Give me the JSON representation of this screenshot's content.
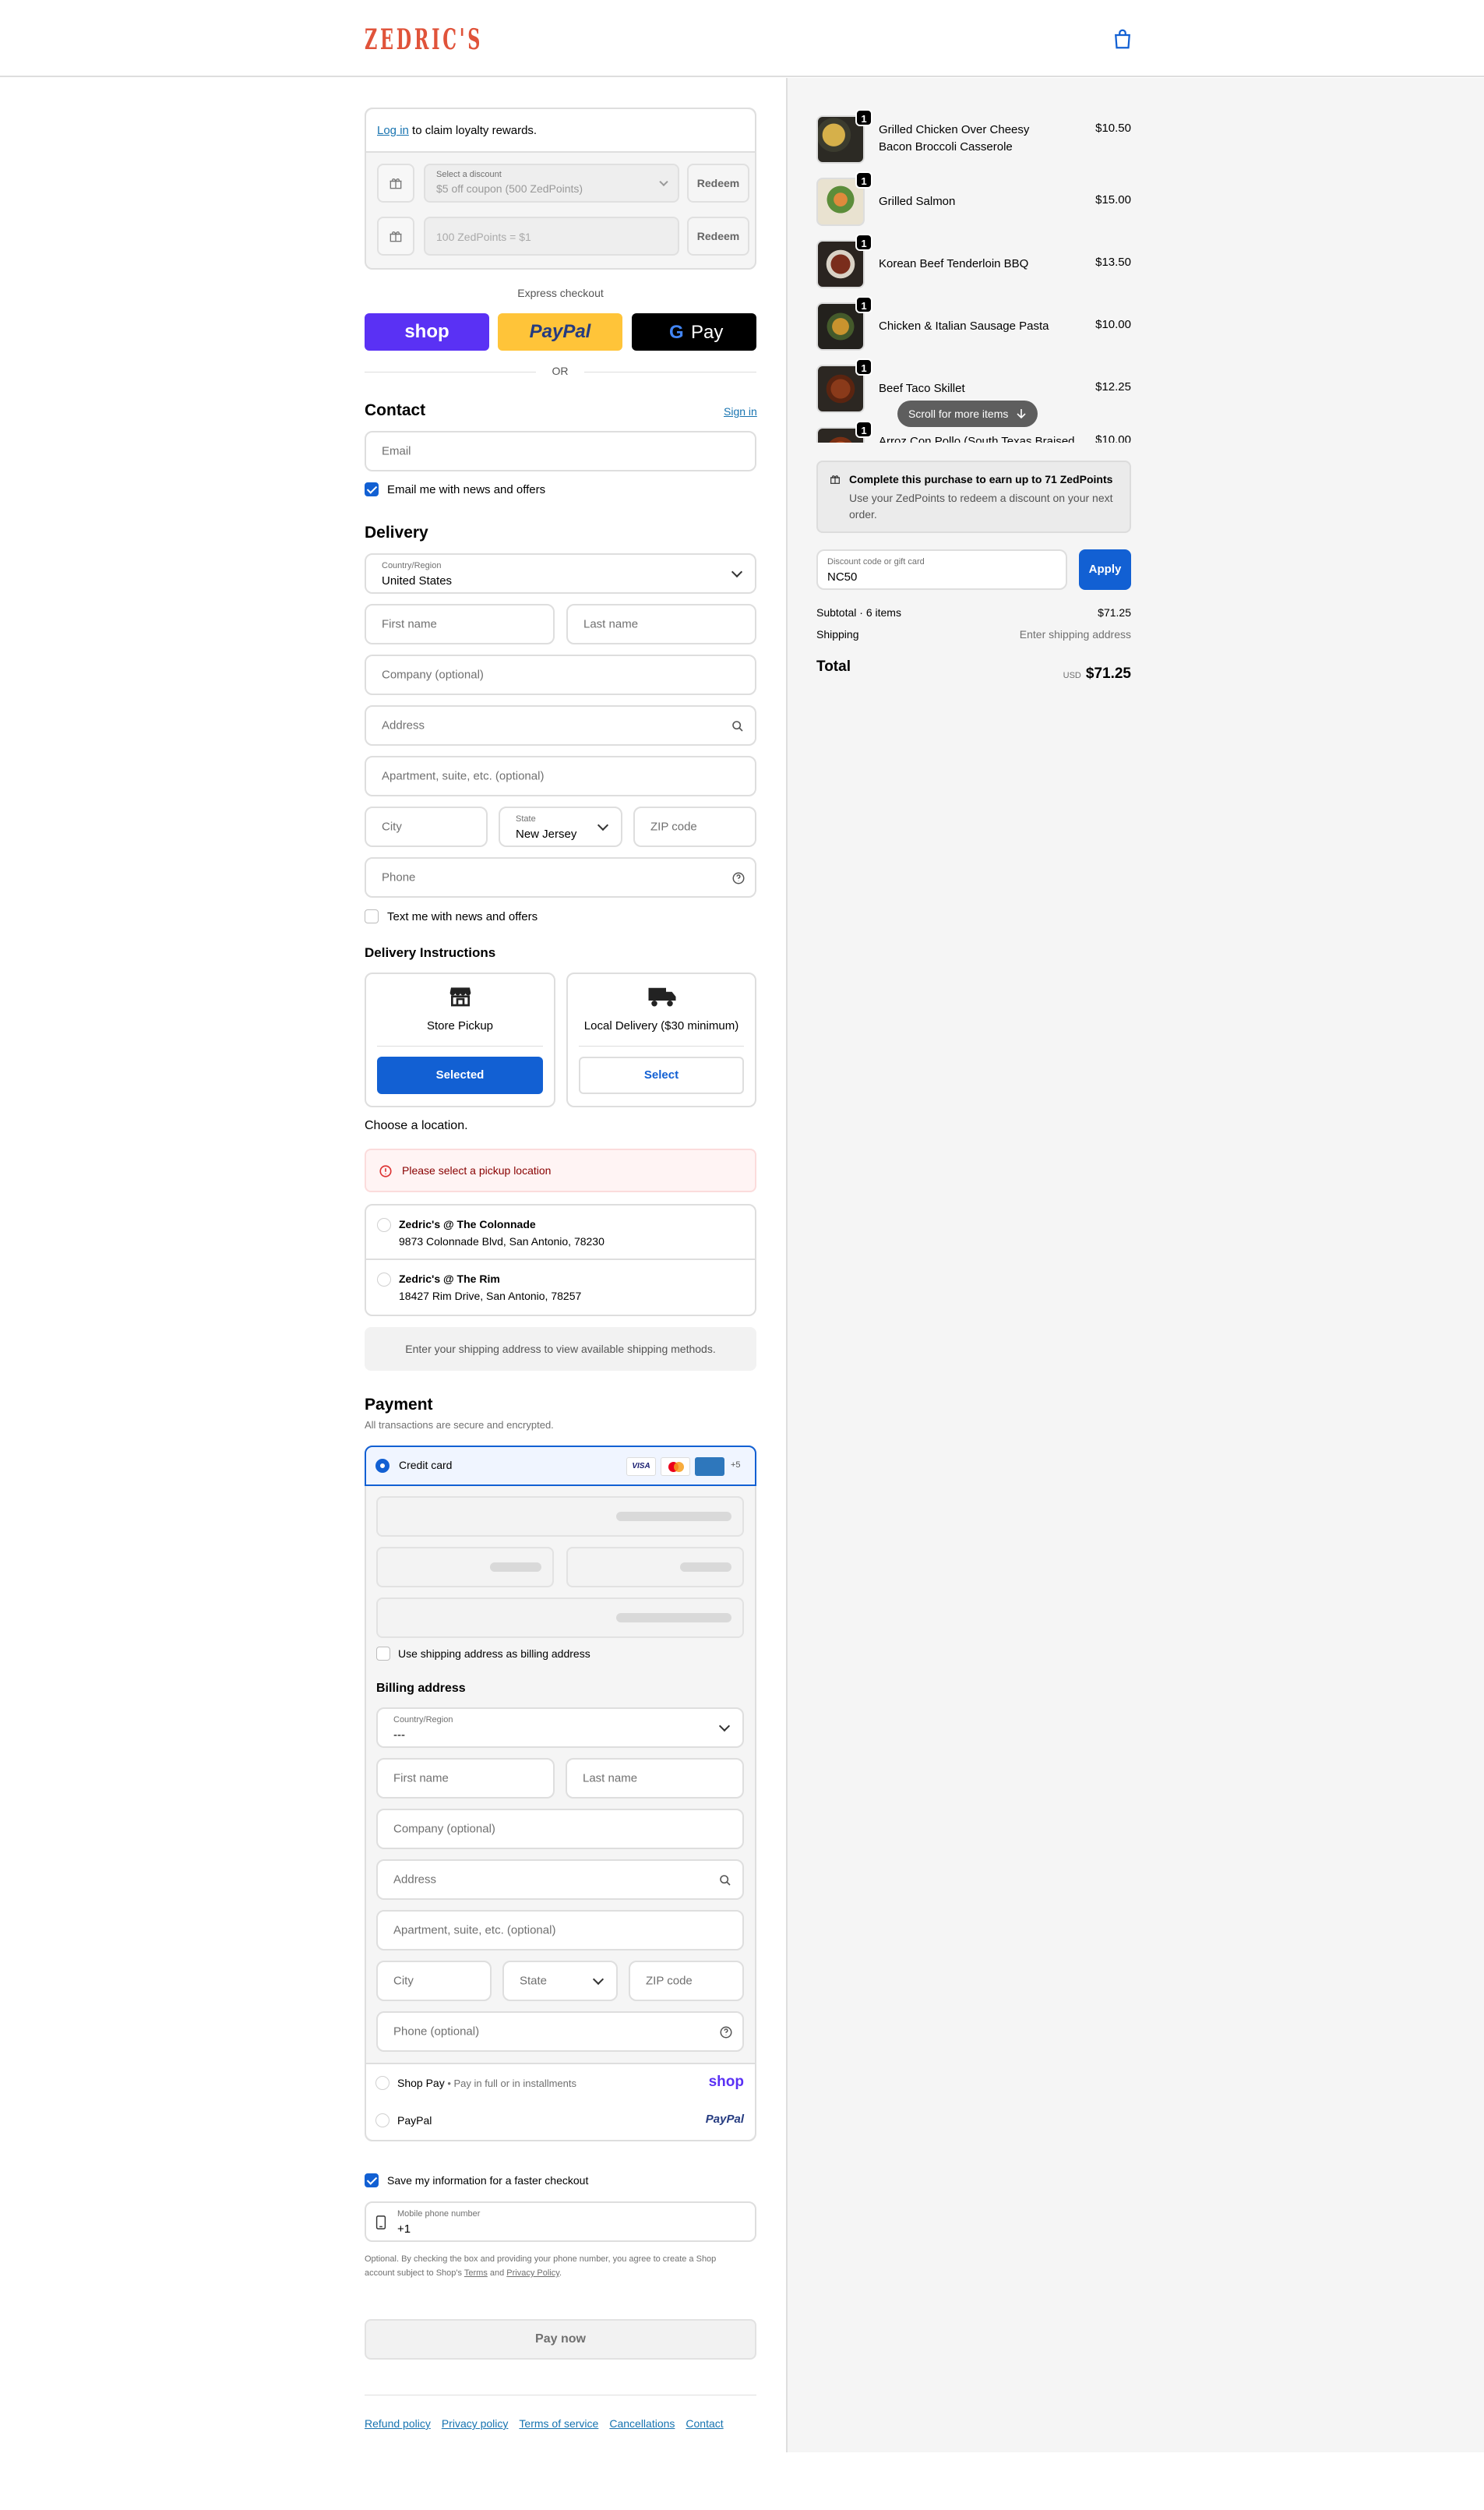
{
  "header": {
    "logo": "ZEDRIC'S",
    "cart_icon": "shopping-bag-icon"
  },
  "loyalty": {
    "login_link": "Log in",
    "login_text": " to claim loyalty rewards.",
    "discount_label": "Select a discount",
    "discount_value": "$5 off coupon (500 ZedPoints)",
    "redeem_label": "Redeem",
    "points_placeholder": "100 ZedPoints = $1",
    "redeem2_label": "Redeem"
  },
  "express": {
    "title": "Express checkout",
    "shop": "shop",
    "paypal": "PayPal",
    "gpay": "Pay",
    "or": "OR"
  },
  "contact": {
    "title": "Contact",
    "signin": "Sign in",
    "email_placeholder": "Email",
    "news_label": "Email me with news and offers"
  },
  "delivery": {
    "title": "Delivery",
    "country_label": "Country/Region",
    "country_value": "United States",
    "first_name": "First name",
    "last_name": "Last name",
    "company": "Company (optional)",
    "address": "Address",
    "apartment": "Apartment, suite, etc. (optional)",
    "city": "City",
    "state_label": "State",
    "state_value": "New Jersey",
    "zip": "ZIP code",
    "phone": "Phone",
    "text_label": "Text me with news and offers"
  },
  "instructions": {
    "title": "Delivery Instructions",
    "pickup_label": "Store Pickup",
    "pickup_button": "Selected",
    "local_label": "Local Delivery ($30 minimum)",
    "local_button": "Select",
    "choose": "Choose a location.",
    "error": "Please select a pickup location",
    "locations": [
      {
        "name": "Zedric's @ The Colonnade",
        "address": "9873 Colonnade Blvd, San Antonio, 78230"
      },
      {
        "name": "Zedric's @ The Rim",
        "address": "18427 Rim Drive, San Antonio, 78257"
      }
    ],
    "shipping_notice": "Enter your shipping address to view available shipping methods."
  },
  "payment": {
    "title": "Payment",
    "subtitle": "All transactions are secure and encrypted.",
    "credit_card": "Credit card",
    "more_cards": "+5",
    "billing_same": "Use shipping address as billing address",
    "billing_title": "Billing address",
    "country_label": "Country/Region",
    "country_value": "---",
    "first_name": "First name",
    "last_name": "Last name",
    "company": "Company (optional)",
    "address": "Address",
    "apartment": "Apartment, suite, etc. (optional)",
    "city": "City",
    "state": "State",
    "zip": "ZIP code",
    "phone": "Phone (optional)",
    "shoppay": "Shop Pay",
    "shoppay_note": " • Pay in full or in installments",
    "shoppay_logo": "shop",
    "paypal": "PayPal",
    "paypal_logo": "PayPal"
  },
  "remember": {
    "save_label": "Save my information for a faster checkout",
    "mobile_label": "Mobile phone number",
    "mobile_value": "+1",
    "legal_1": "Optional. By checking the box and providing your phone number, you agree to create a Shop",
    "legal_2a": "account subject to Shop's ",
    "terms": "Terms",
    "and": " and ",
    "privacy": "Privacy Policy",
    "dot": "."
  },
  "pay_button": "Pay now",
  "footer": [
    "Refund policy",
    "Privacy policy",
    "Terms of service",
    "Cancellations",
    "Contact"
  ],
  "summary": {
    "items": [
      {
        "qty": "1",
        "name": "Grilled Chicken Over Cheesy Bacon Broccoli Casserole",
        "price": "$10.50"
      },
      {
        "qty": "1",
        "name": "Grilled Salmon",
        "price": "$15.00"
      },
      {
        "qty": "1",
        "name": "Korean Beef Tenderloin BBQ",
        "price": "$13.50"
      },
      {
        "qty": "1",
        "name": "Chicken & Italian Sausage Pasta",
        "price": "$10.00"
      },
      {
        "qty": "1",
        "name": "Beef Taco Skillet",
        "price": "$12.25"
      },
      {
        "qty": "1",
        "name": "Arroz Con Pollo (South Texas Braised",
        "price": "$10.00"
      }
    ],
    "scroll_hint": "Scroll for more items",
    "rewards_title": "Complete this purchase to earn up to 71 ZedPoints",
    "rewards_text": "Use your ZedPoints to redeem a discount on your next order.",
    "discount_label": "Discount code or gift card",
    "discount_value": "NC50",
    "apply": "Apply",
    "subtotal_label": "Subtotal · 6 items",
    "subtotal_value": "$71.25",
    "shipping_label": "Shipping",
    "shipping_value": "Enter shipping address",
    "total_label": "Total",
    "currency": "USD",
    "total_value": "$71.25"
  },
  "colors": {
    "accent": "#1260d3",
    "shop": "#5a31f4",
    "paypal": "#ffc439",
    "logo": "#e0533a",
    "error_bg": "#fff4f4"
  }
}
